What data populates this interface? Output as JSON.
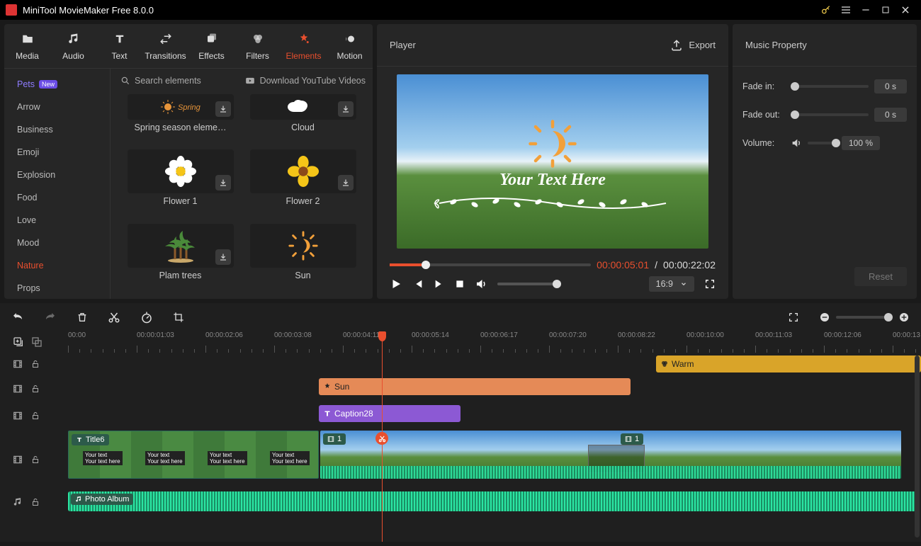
{
  "app": {
    "title": "MiniTool MovieMaker Free 8.0.0"
  },
  "ribbon": [
    {
      "label": "Media",
      "icon": "folder"
    },
    {
      "label": "Audio",
      "icon": "music"
    },
    {
      "label": "Text",
      "icon": "text"
    },
    {
      "label": "Transitions",
      "icon": "arrows"
    },
    {
      "label": "Effects",
      "icon": "layers"
    },
    {
      "label": "Filters",
      "icon": "filter"
    },
    {
      "label": "Elements",
      "icon": "sparkle",
      "active": true
    },
    {
      "label": "Motion",
      "icon": "motion"
    }
  ],
  "categories": [
    {
      "label": "Pets",
      "new": true
    },
    {
      "label": "Arrow"
    },
    {
      "label": "Business"
    },
    {
      "label": "Emoji"
    },
    {
      "label": "Explosion"
    },
    {
      "label": "Food"
    },
    {
      "label": "Love"
    },
    {
      "label": "Mood"
    },
    {
      "label": "Nature",
      "active": true
    },
    {
      "label": "Props"
    }
  ],
  "search": {
    "placeholder": "Search elements",
    "youtube": "Download YouTube Videos"
  },
  "elements": [
    {
      "name": "Spring season eleme…",
      "short": true
    },
    {
      "name": "Cloud",
      "short": true
    },
    {
      "name": "Flower 1"
    },
    {
      "name": "Flower 2"
    },
    {
      "name": "Plam trees"
    },
    {
      "name": "Sun"
    }
  ],
  "player": {
    "title": "Player",
    "export": "Export",
    "overlay_text": "Your Text Here",
    "current": "00:00:05:01",
    "total": "00:00:22:02",
    "sep": "/",
    "aspect": "16:9"
  },
  "music_panel": {
    "title": "Music Property",
    "fade_in_label": "Fade in:",
    "fade_in_value": "0 s",
    "fade_out_label": "Fade out:",
    "fade_out_value": "0 s",
    "volume_label": "Volume:",
    "volume_value": "100 %",
    "reset": "Reset"
  },
  "ruler_labels": [
    "00:00",
    "00:00:01:03",
    "00:00:02:06",
    "00:00:03:08",
    "00:00:04:11",
    "00:00:05:14",
    "00:00:06:17",
    "00:00:07:20",
    "00:00:08:22",
    "00:00:10:00",
    "00:00:11:03",
    "00:00:12:06",
    "00:00:13"
  ],
  "clips": {
    "warm": "Warm",
    "sun": "Sun",
    "caption": "Caption28",
    "title": "Title6",
    "v2tag": "1",
    "audio": "Photo Album"
  }
}
